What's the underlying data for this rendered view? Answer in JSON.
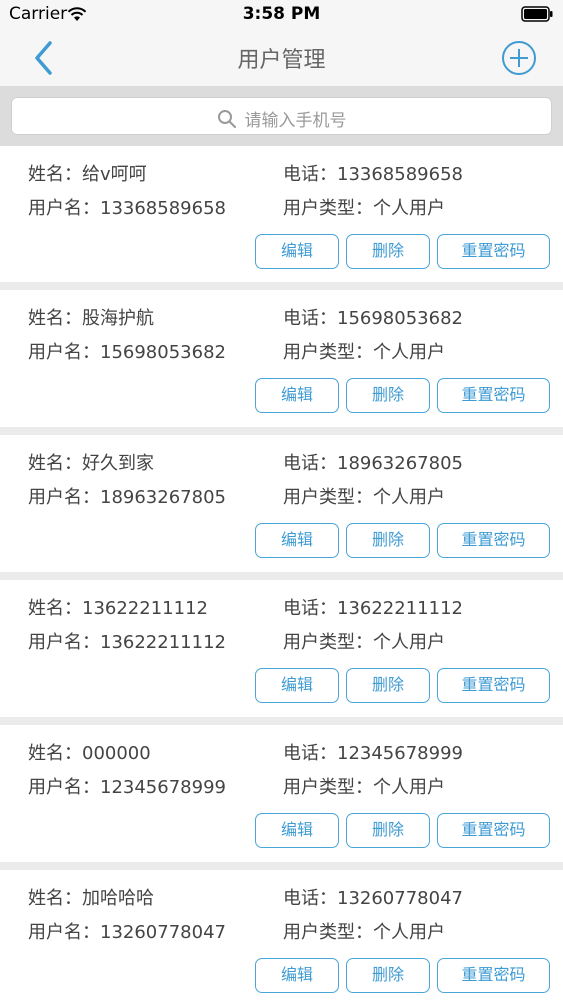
{
  "status_bar": {
    "carrier": "Carrier",
    "time": "3:58 PM"
  },
  "nav": {
    "title": "用户管理",
    "back_icon": "chevron-left-icon",
    "add_icon": "plus-circle-icon"
  },
  "search": {
    "placeholder": "请输入手机号"
  },
  "labels": {
    "name": "姓名：",
    "phone": "电话：",
    "username": "用户名：",
    "user_type": "用户类型："
  },
  "buttons": {
    "edit": "编辑",
    "delete": "删除",
    "reset_password": "重置密码"
  },
  "users": [
    {
      "name": "给v呵呵",
      "phone": "13368589658",
      "username": "13368589658",
      "type": "个人用户"
    },
    {
      "name": "股海护航",
      "phone": "15698053682",
      "username": "15698053682",
      "type": "个人用户"
    },
    {
      "name": "好久到家",
      "phone": "18963267805",
      "username": "18963267805",
      "type": "个人用户"
    },
    {
      "name": "13622211112",
      "phone": "13622211112",
      "username": "13622211112",
      "type": "个人用户"
    },
    {
      "name": "000000",
      "phone": "12345678999",
      "username": "12345678999",
      "type": "个人用户"
    },
    {
      "name": "加哈哈哈",
      "phone": "13260778047",
      "username": "13260778047",
      "type": "个人用户"
    }
  ],
  "colors": {
    "accent": "#3f9bd3",
    "nav_background": "#f6f6f6",
    "list_background": "#ebebeb"
  }
}
